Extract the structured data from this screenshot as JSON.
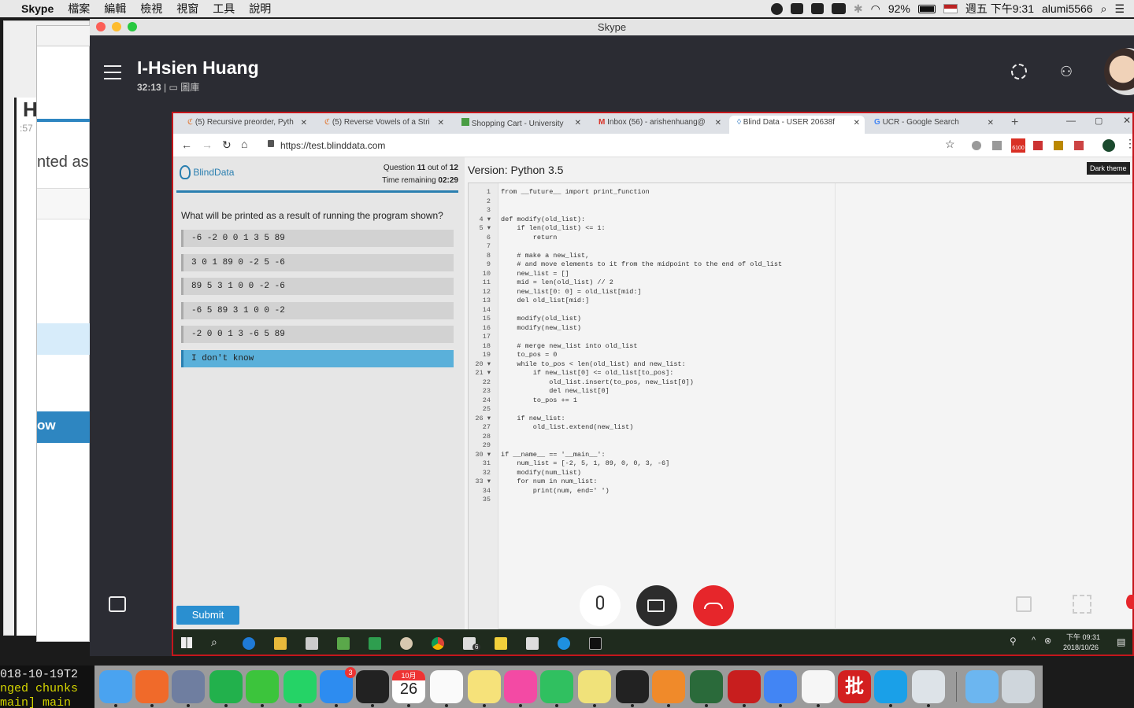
{
  "menubar": {
    "app_name": "Skype",
    "items": [
      "檔案",
      "編輯",
      "檢視",
      "視窗",
      "工具",
      "說明"
    ],
    "battery": "92%",
    "clock": "週五 下午9:31",
    "user": "alumi5566"
  },
  "background_windows": {
    "large_letter": "H",
    "time_fragment": ":57",
    "text_fragment": "nted as",
    "button_fragment": "ow"
  },
  "terminal": {
    "lines": [
      "018-10-19T2",
      "nged chunks",
      "main] main"
    ]
  },
  "skype": {
    "window_title": "Skype",
    "contact_name": "I-Hsien Huang",
    "call_duration": "32:13",
    "separator": "|",
    "gallery_label": "圖庫"
  },
  "browser": {
    "tabs": [
      {
        "title": "(5) Recursive preorder, Pyth",
        "icon_color": "#e07b39"
      },
      {
        "title": "(5) Reverse Vowels of a Stri",
        "icon_color": "#e07b39"
      },
      {
        "title": "Shopping Cart - University",
        "icon_color": "#4a9d44"
      },
      {
        "title": "Inbox (56) - arishenhuang@",
        "icon_color": "#d93025"
      },
      {
        "title": "Blind Data - USER 20638f",
        "icon_color": "#4a8ac9"
      },
      {
        "title": "UCR - Google Search",
        "icon_color": "#4285f4"
      }
    ],
    "url": "https://test.blinddata.com",
    "new_tab_label": "+",
    "notification_count": "6100"
  },
  "quiz": {
    "logo_text": "BlindData",
    "question_prefix": "Question",
    "question_num": "11",
    "question_out_of": "out of",
    "question_total": "12",
    "time_label": "Time remaining",
    "time_value": "02:29",
    "question": "What will be printed as a result of running the program shown?",
    "options": [
      "-6 -2 0 0 1 3 5 89",
      "3 0 1 89 0 -2 5 -6",
      "89 5 3 1 0 0 -2 -6",
      "-6 5 89 3 1 0 0 -2",
      "-2 0 0 1 3 -6 5 89",
      "I don't know"
    ],
    "selected_index": 5,
    "submit_label": "Submit"
  },
  "editor": {
    "version_label": "Version: Python 3.5",
    "theme_tooltip": "Dark theme",
    "line_numbers": [
      "1",
      "2",
      "3",
      "4 ▾",
      "5 ▾",
      "6",
      "7",
      "8",
      "9",
      "10",
      "11",
      "12",
      "13",
      "14",
      "15",
      "16",
      "17",
      "18",
      "19",
      "20 ▾",
      "21 ▾",
      "22",
      "23",
      "24",
      "25",
      "26 ▾",
      "27",
      "28",
      "29",
      "30 ▾",
      "31",
      "32",
      "33 ▾",
      "34",
      "35"
    ],
    "code_lines": [
      "from __future__ import print_function",
      "",
      "",
      "def modify(old_list):",
      "    if len(old_list) <= 1:",
      "        return",
      "",
      "    # make a new_list,",
      "    # and move elements to it from the midpoint to the end of old_list",
      "    new_list = []",
      "    mid = len(old_list) // 2",
      "    new_list[0: 0] = old_list[mid:]",
      "    del old_list[mid:]",
      "",
      "    modify(old_list)",
      "    modify(new_list)",
      "",
      "    # merge new_list into old_list",
      "    to_pos = 0",
      "    while to_pos < len(old_list) and new_list:",
      "        if new_list[0] <= old_list[to_pos]:",
      "            old_list.insert(to_pos, new_list[0])",
      "            del new_list[0]",
      "        to_pos += 1",
      "",
      "    if new_list:",
      "        old_list.extend(new_list)",
      "",
      "",
      "if __name__ == '__main__':",
      "    num_list = [-2, 5, 1, 89, 0, 0, 3, -6]",
      "    modify(num_list)",
      "    for num in num_list:",
      "        print(num, end=' ')",
      ""
    ]
  },
  "windows_taskbar": {
    "time": "下午 09:31",
    "date": "2018/10/26",
    "mail_badge": "6"
  },
  "dock": {
    "calendar_month": "10月",
    "calendar_day": "26",
    "appstore_badge": "3",
    "apps": [
      "Finder",
      "Firefox",
      "Launchpad",
      "LINE",
      "WeChat",
      "WhatsApp",
      "App Store",
      "Terminal",
      "Calendar",
      "Reminders",
      "Notes",
      "iTunes",
      "Messages",
      "Stickies",
      "GitHub",
      "Sublime Text",
      "Scrivener",
      "FileZilla",
      "Chrome",
      "TextEdit",
      "批",
      "Skype",
      "Preview",
      "Folder",
      "Trash"
    ]
  }
}
